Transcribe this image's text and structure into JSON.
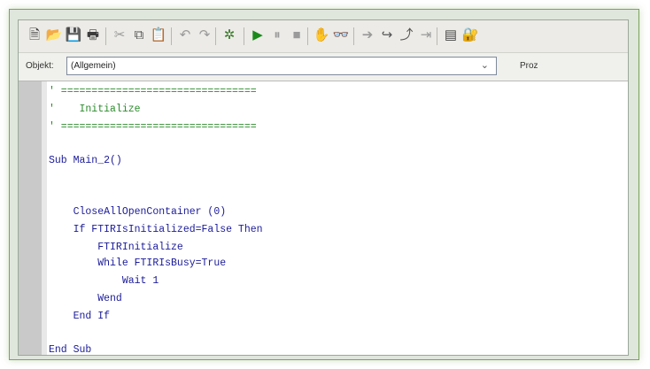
{
  "toolbar": {
    "buttons": [
      {
        "name": "new-icon",
        "glyph": "🗎",
        "color": "#3c3c3c"
      },
      {
        "name": "open-folder-icon",
        "glyph": "📂",
        "color": "#3c3c3c"
      },
      {
        "name": "save-icon",
        "glyph": "💾",
        "color": "#5a5a5a"
      },
      {
        "name": "print-icon",
        "glyph": "🖶",
        "color": "#3c3c3c"
      },
      {
        "name": "cut-icon",
        "glyph": "✂",
        "color": "#9a9a9a"
      },
      {
        "name": "copy-icon",
        "glyph": "⧉",
        "color": "#555555"
      },
      {
        "name": "paste-icon",
        "glyph": "📋",
        "color": "#666666"
      },
      {
        "name": "undo-icon",
        "glyph": "↶",
        "color": "#9a9a9a"
      },
      {
        "name": "redo-icon",
        "glyph": "↷",
        "color": "#9a9a9a"
      },
      {
        "name": "debug-icon",
        "glyph": "✲",
        "color": "#3a7a2a"
      },
      {
        "name": "run-icon",
        "glyph": "▶",
        "color": "#1a8a1a"
      },
      {
        "name": "pause-icon",
        "glyph": "⏸",
        "color": "#9a9a9a"
      },
      {
        "name": "stop-icon",
        "glyph": "■",
        "color": "#9a9a9a"
      },
      {
        "name": "hand-icon",
        "glyph": "✋",
        "color": "#444444"
      },
      {
        "name": "watch-icon",
        "glyph": "👓",
        "color": "#444444"
      },
      {
        "name": "step-into-icon",
        "glyph": "➔",
        "color": "#9a9a9a"
      },
      {
        "name": "step-over-icon",
        "glyph": "↪",
        "color": "#555555"
      },
      {
        "name": "step-out-icon",
        "glyph": "⤴",
        "color": "#555555"
      },
      {
        "name": "breakpoint-icon",
        "glyph": "⇥",
        "color": "#9a9a9a"
      },
      {
        "name": "window-icon",
        "glyph": "▤",
        "color": "#444444"
      },
      {
        "name": "properties-icon",
        "glyph": "🔐",
        "color": "#777777"
      }
    ]
  },
  "object_row": {
    "label": "Objekt:",
    "value": "(Allgemein)",
    "proc_label": "Proz"
  },
  "code_lines": [
    {
      "text": "' ================================",
      "cls": "green"
    },
    {
      "text": "'    Initialize",
      "cls": "green"
    },
    {
      "text": "' ================================",
      "cls": "green"
    },
    {
      "text": "",
      "cls": ""
    },
    {
      "text": "Sub Main_2()",
      "cls": "kw"
    },
    {
      "text": "",
      "cls": ""
    },
    {
      "text": "",
      "cls": ""
    },
    {
      "text": "    CloseAllOpenContainer (0)",
      "cls": "kw"
    },
    {
      "text": "    If FTIRIsInitialized=False Then",
      "cls": "kw"
    },
    {
      "text": "        FTIRInitialize",
      "cls": "kw"
    },
    {
      "text": "        While FTIRIsBusy=True",
      "cls": "kw"
    },
    {
      "text": "            Wait 1",
      "cls": "kw"
    },
    {
      "text": "        Wend",
      "cls": "kw"
    },
    {
      "text": "    End If",
      "cls": "kw"
    },
    {
      "text": "",
      "cls": ""
    },
    {
      "text": "End Sub",
      "cls": "kw"
    }
  ]
}
